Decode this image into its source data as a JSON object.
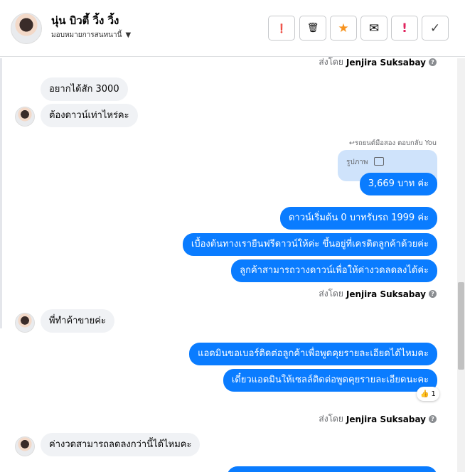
{
  "header": {
    "name": "นุ่น บิวตี้ วิ้ง วิ้ง",
    "assign": "มอบหมายการสนทนานี้"
  },
  "toolbar": {
    "alert_icon": "❗",
    "trash_icon": "🗑",
    "star_icon": "★",
    "mail_icon": "✉",
    "spam_icon": "!",
    "check_icon": "✓"
  },
  "labels": {
    "sent_by": "ส่งโดย",
    "sender": "Jenjira Suksabay",
    "reply_hint": "↩รถยนต์มือสอง ตอบกลับ You",
    "photo": "รูปภาพ",
    "reaction_count": "1"
  },
  "messages": [
    "อยากได้สัก 3000",
    "ต้องดาวน์เท่าไหร่คะ",
    "3,669 บาท ค่ะ",
    "ดาวน์เริ่มต้น 0 บาทรับรถ 1999 ค่ะ",
    "เบื้องต้นทางเรายืนฟรีดาวน์ให้ค่ะ ขึ้นอยู่ที่เครดิตลูกค้าด้วยค่ะ",
    "ลูกค้าสามารถวางดาวน์เพื่อให้ค่างวดลดลงได้ค่ะ",
    "พี่ทำค้าขายค่ะ",
    "แอดมินขอเบอร์ติดต่อลูกค้าเพื่อพูดคุยรายละเอียดได้ไหมคะ",
    "เดี๋ยวแอดมินให้เซลล์ติดต่อพูดคุยรายละเอียดนะคะ",
    "ค่างวดสามารถลดลงกว่านี้ได้ไหมคะ"
  ]
}
